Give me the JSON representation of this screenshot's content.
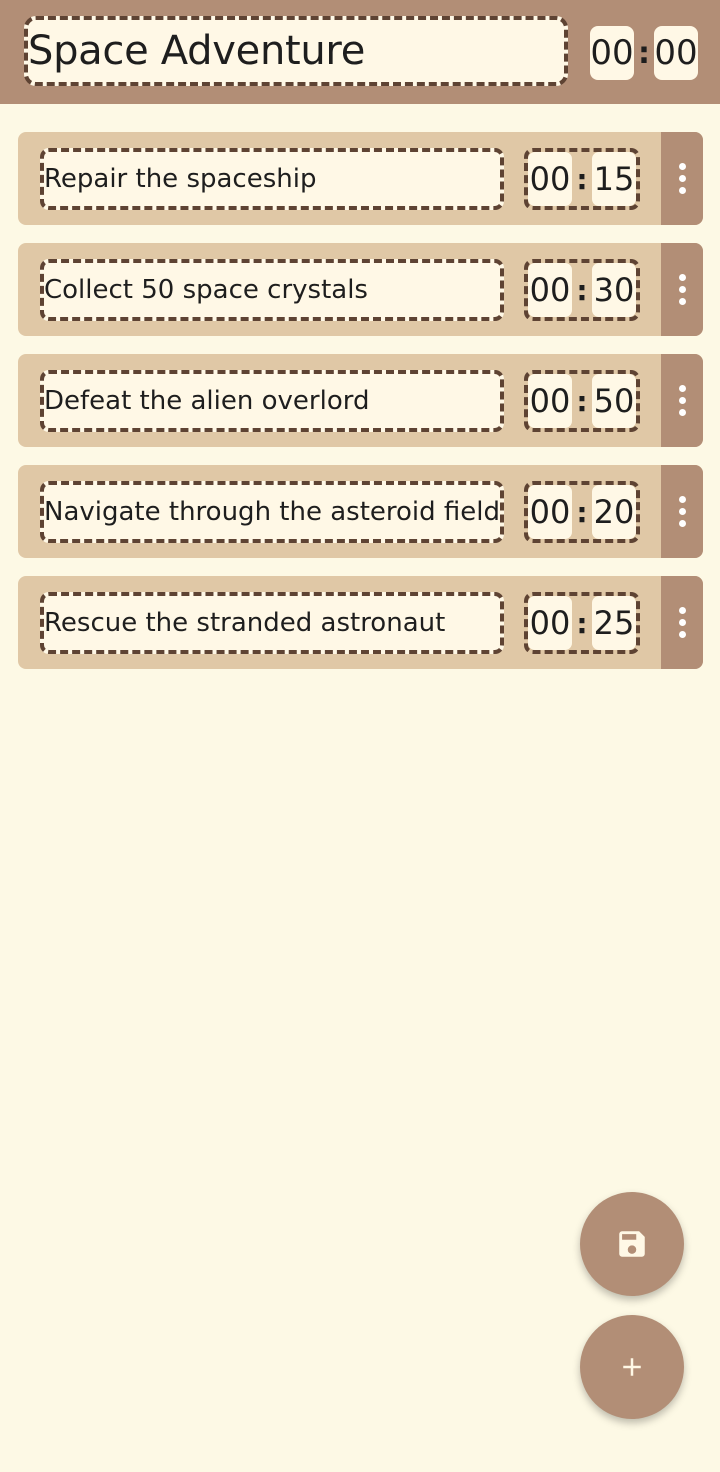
{
  "header": {
    "title": "Space Adventure",
    "timer": {
      "minutes": "00",
      "seconds": "00",
      "separator": ":"
    }
  },
  "tasks": [
    {
      "label": "Repair the spaceship",
      "minutes": "00",
      "seconds": "15"
    },
    {
      "label": "Collect 50 space crystals",
      "minutes": "00",
      "seconds": "30"
    },
    {
      "label": "Defeat the alien overlord",
      "minutes": "00",
      "seconds": "50"
    },
    {
      "label": "Navigate through the asteroid field",
      "minutes": "00",
      "seconds": "20"
    },
    {
      "label": "Rescue the stranded astronaut",
      "minutes": "00",
      "seconds": "25"
    }
  ],
  "separator": ":",
  "actions": {
    "save_icon": "floppy-disk-icon",
    "add_icon": "plus-icon"
  },
  "colors": {
    "background": "#FDF9E5",
    "accent": "#B28E76",
    "card": "#E0C8A6",
    "field": "#FFF8E6",
    "dashed_border": "#5E4333"
  }
}
